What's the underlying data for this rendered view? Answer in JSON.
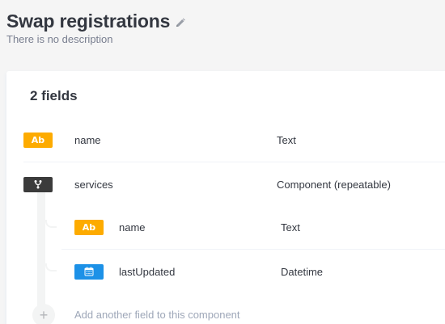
{
  "header": {
    "title": "Swap registrations",
    "description": "There is no description"
  },
  "fields_count": "2 fields",
  "fields": [
    {
      "badge": "Ab",
      "name": "name",
      "type": "Text"
    },
    {
      "badge": "",
      "name": "services",
      "type": "Component (repeatable)"
    }
  ],
  "component_fields": [
    {
      "badge": "Ab",
      "name": "name",
      "type": "Text"
    },
    {
      "badge": "",
      "name": "lastUpdated",
      "type": "Datetime"
    }
  ],
  "add_field_label": "Add another field to this component",
  "add_symbol": "+",
  "icons": {
    "edit": "pencil-icon",
    "component": "component-branch-icon",
    "date": "calendar-icon",
    "add": "plus-icon"
  },
  "colors": {
    "text_badge": "#fdab00",
    "component_badge": "#3b3b3b",
    "date_badge": "#1c91e7"
  }
}
